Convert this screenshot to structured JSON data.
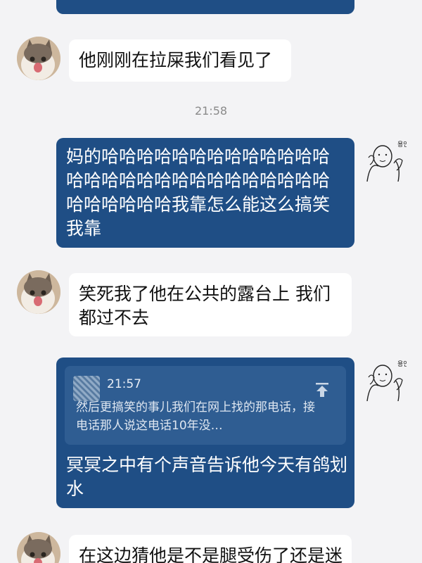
{
  "conversation": {
    "messages": [
      {
        "text": "他刚刚在拉屎我们看见了"
      },
      {
        "text": "妈的哈哈哈哈哈哈哈哈哈哈哈哈哈哈哈哈哈哈哈哈哈哈哈哈哈哈哈哈哈哈哈哈哈哈我靠怎么能这么搞笑我靠"
      },
      {
        "text": "笑死我了他在公共的露台上 我们都过不去"
      },
      {
        "text": "冥冥之中有个声音告诉他今天有鸽划水"
      },
      {
        "text": "在这边猜他是不是腿受伤了还是迷"
      }
    ],
    "time_separator": "21:58",
    "quote": {
      "time": "21:57",
      "text": "然后更搞笑的事儿我们在网上找的那电话，接电话那人说这电话10年没…"
    }
  },
  "avatars": {
    "me_badge_text": "용안대"
  },
  "colors": {
    "outgoing_bubble": "#1f4e85",
    "incoming_bubble": "#ffffff",
    "background": "#f3f3f5",
    "timestamp": "#8a8a8a"
  },
  "icons": {
    "quote_jump": "arrow-up-to-line-icon"
  }
}
